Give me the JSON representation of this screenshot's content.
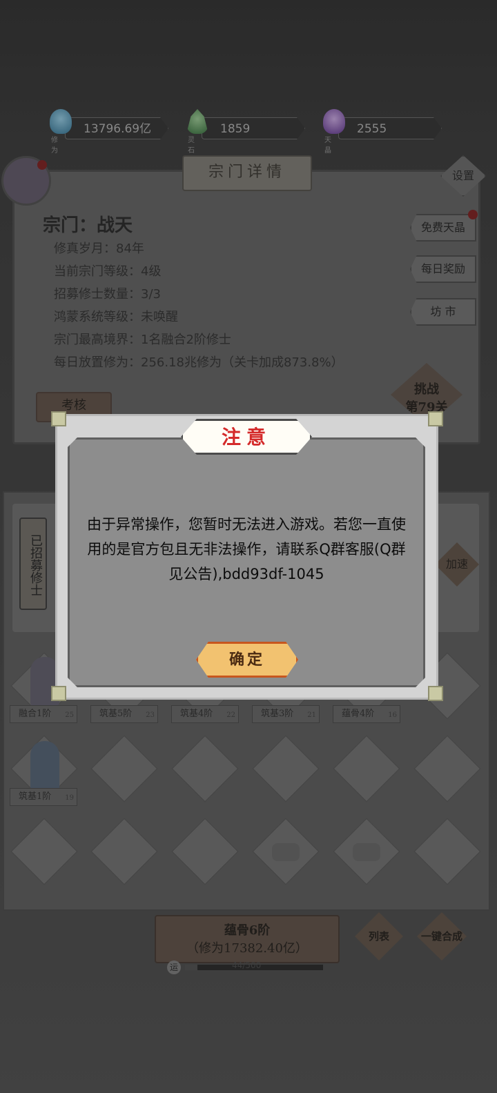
{
  "resources": [
    {
      "label": "修为",
      "value": "13796.69亿",
      "icon": "cultivation-flame-icon",
      "color": "#6aa6c8"
    },
    {
      "label": "灵石",
      "value": "1859",
      "icon": "spirit-stone-icon",
      "color": "#6e9a6e"
    },
    {
      "label": "天晶",
      "value": "2555",
      "icon": "heaven-crystal-icon",
      "color": "#8a6ab0"
    }
  ],
  "panel": {
    "title": "宗门详情",
    "settings_label": "设置",
    "sect_name": "宗门：战天",
    "info": [
      "修真岁月：84年",
      "当前宗门等级：4级",
      "招募修士数量：3/3",
      "鸿蒙系统等级：未唤醒",
      "宗门最高境界：1名融合2阶修士",
      "每日放置修为：256.18兆修为（关卡加成873.8%）"
    ],
    "side_buttons": [
      "免费天晶",
      "每日奖励",
      "坊 市"
    ],
    "challenge_label": "挑战\n第79关",
    "practice_label": "考核"
  },
  "lower": {
    "recruited_label": "已招募修士",
    "speed_label": "加速",
    "row1_tags": [
      {
        "name": "融合1阶",
        "num": "25"
      },
      {
        "name": "筑基5阶",
        "num": "23"
      },
      {
        "name": "筑基4阶",
        "num": "22"
      },
      {
        "name": "筑基3阶",
        "num": "21"
      },
      {
        "name": "蕴骨4阶",
        "num": "16"
      }
    ],
    "row2_tags": [
      {
        "name": "筑基1阶",
        "num": "19"
      }
    ]
  },
  "bottom": {
    "fuse_title": "蕴骨6阶",
    "fuse_sub": "（修为17382.40亿）",
    "list_label": "列表",
    "merge_label": "一键合成",
    "luck_label": "运",
    "progress_text": "44/500",
    "progress_fraction": 0.088
  },
  "modal": {
    "title": "注意",
    "message": "由于异常操作，您暂时无法进入游戏。若您一直使用的是官方包且无非法操作，请联系Q群客服(Q群见公告),bdd93df-1045",
    "confirm_label": "确定"
  }
}
